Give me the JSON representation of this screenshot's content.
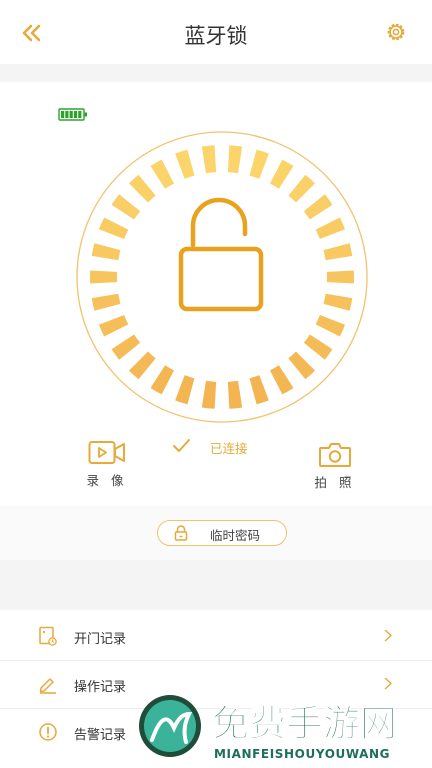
{
  "header": {
    "title": "蓝牙锁"
  },
  "device": {
    "status": "已连接",
    "record_label": "录 像",
    "photo_label": "拍 照",
    "temp_password_label": "临时密码"
  },
  "menu": {
    "items": [
      {
        "label": "开门记录"
      },
      {
        "label": "操作记录"
      },
      {
        "label": "告警记录"
      }
    ]
  },
  "watermark": {
    "text": "免费手游网",
    "subtext": "MIANFEISHOUYOUWANG"
  },
  "colors": {
    "accent": "#e6a93a",
    "battery": "#2aa52a",
    "segment_light": "#fbd56b",
    "segment_dark": "#f3b451"
  }
}
